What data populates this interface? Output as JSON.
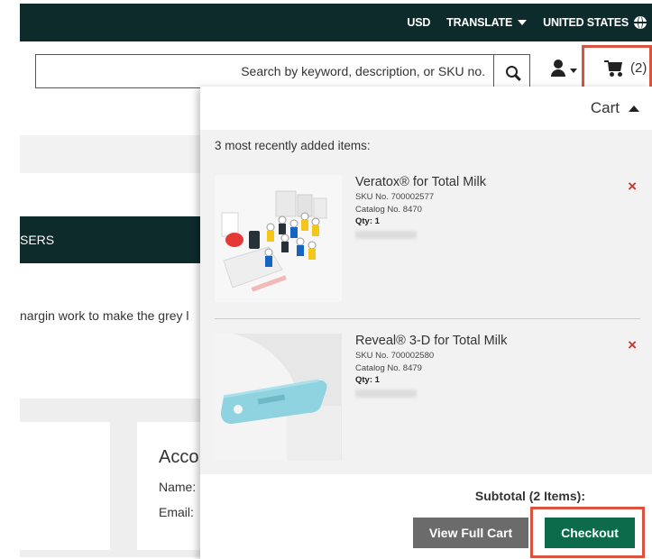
{
  "topbar": {
    "currency": "USD",
    "translate": "TRANSLATE",
    "region": "UNITED STATES"
  },
  "search": {
    "placeholder": "Search by keyword, description, or SKU no."
  },
  "cart_button": {
    "count": "(2)"
  },
  "background": {
    "nav_text": "SERS",
    "body_text": "nargin work to make the grey l",
    "account_title": "Acco",
    "name_label": "Name:",
    "email_label": "Email:"
  },
  "cart_panel": {
    "title": "Cart",
    "recent_label": "3 most recently added items:",
    "items": [
      {
        "name": "Veratox® for Total Milk",
        "sku": "SKU No. 700002577",
        "catalog": "Catalog No. 8470",
        "qty": "Qty: 1"
      },
      {
        "name": "Reveal® 3-D for Total Milk",
        "sku": "SKU No. 700002580",
        "catalog": "Catalog No. 8479",
        "qty": "Qty: 1"
      }
    ],
    "remove_glyph": "×",
    "subtotal": "Subtotal (2 Items):",
    "view_cart_label": "View Full Cart",
    "checkout_label": "Checkout"
  },
  "colors": {
    "topbar": "#0d2b2b",
    "checkout": "#0b6b4a",
    "view_cart": "#6b6b6b",
    "highlight": "#d9533f",
    "remove": "#c0392b"
  }
}
